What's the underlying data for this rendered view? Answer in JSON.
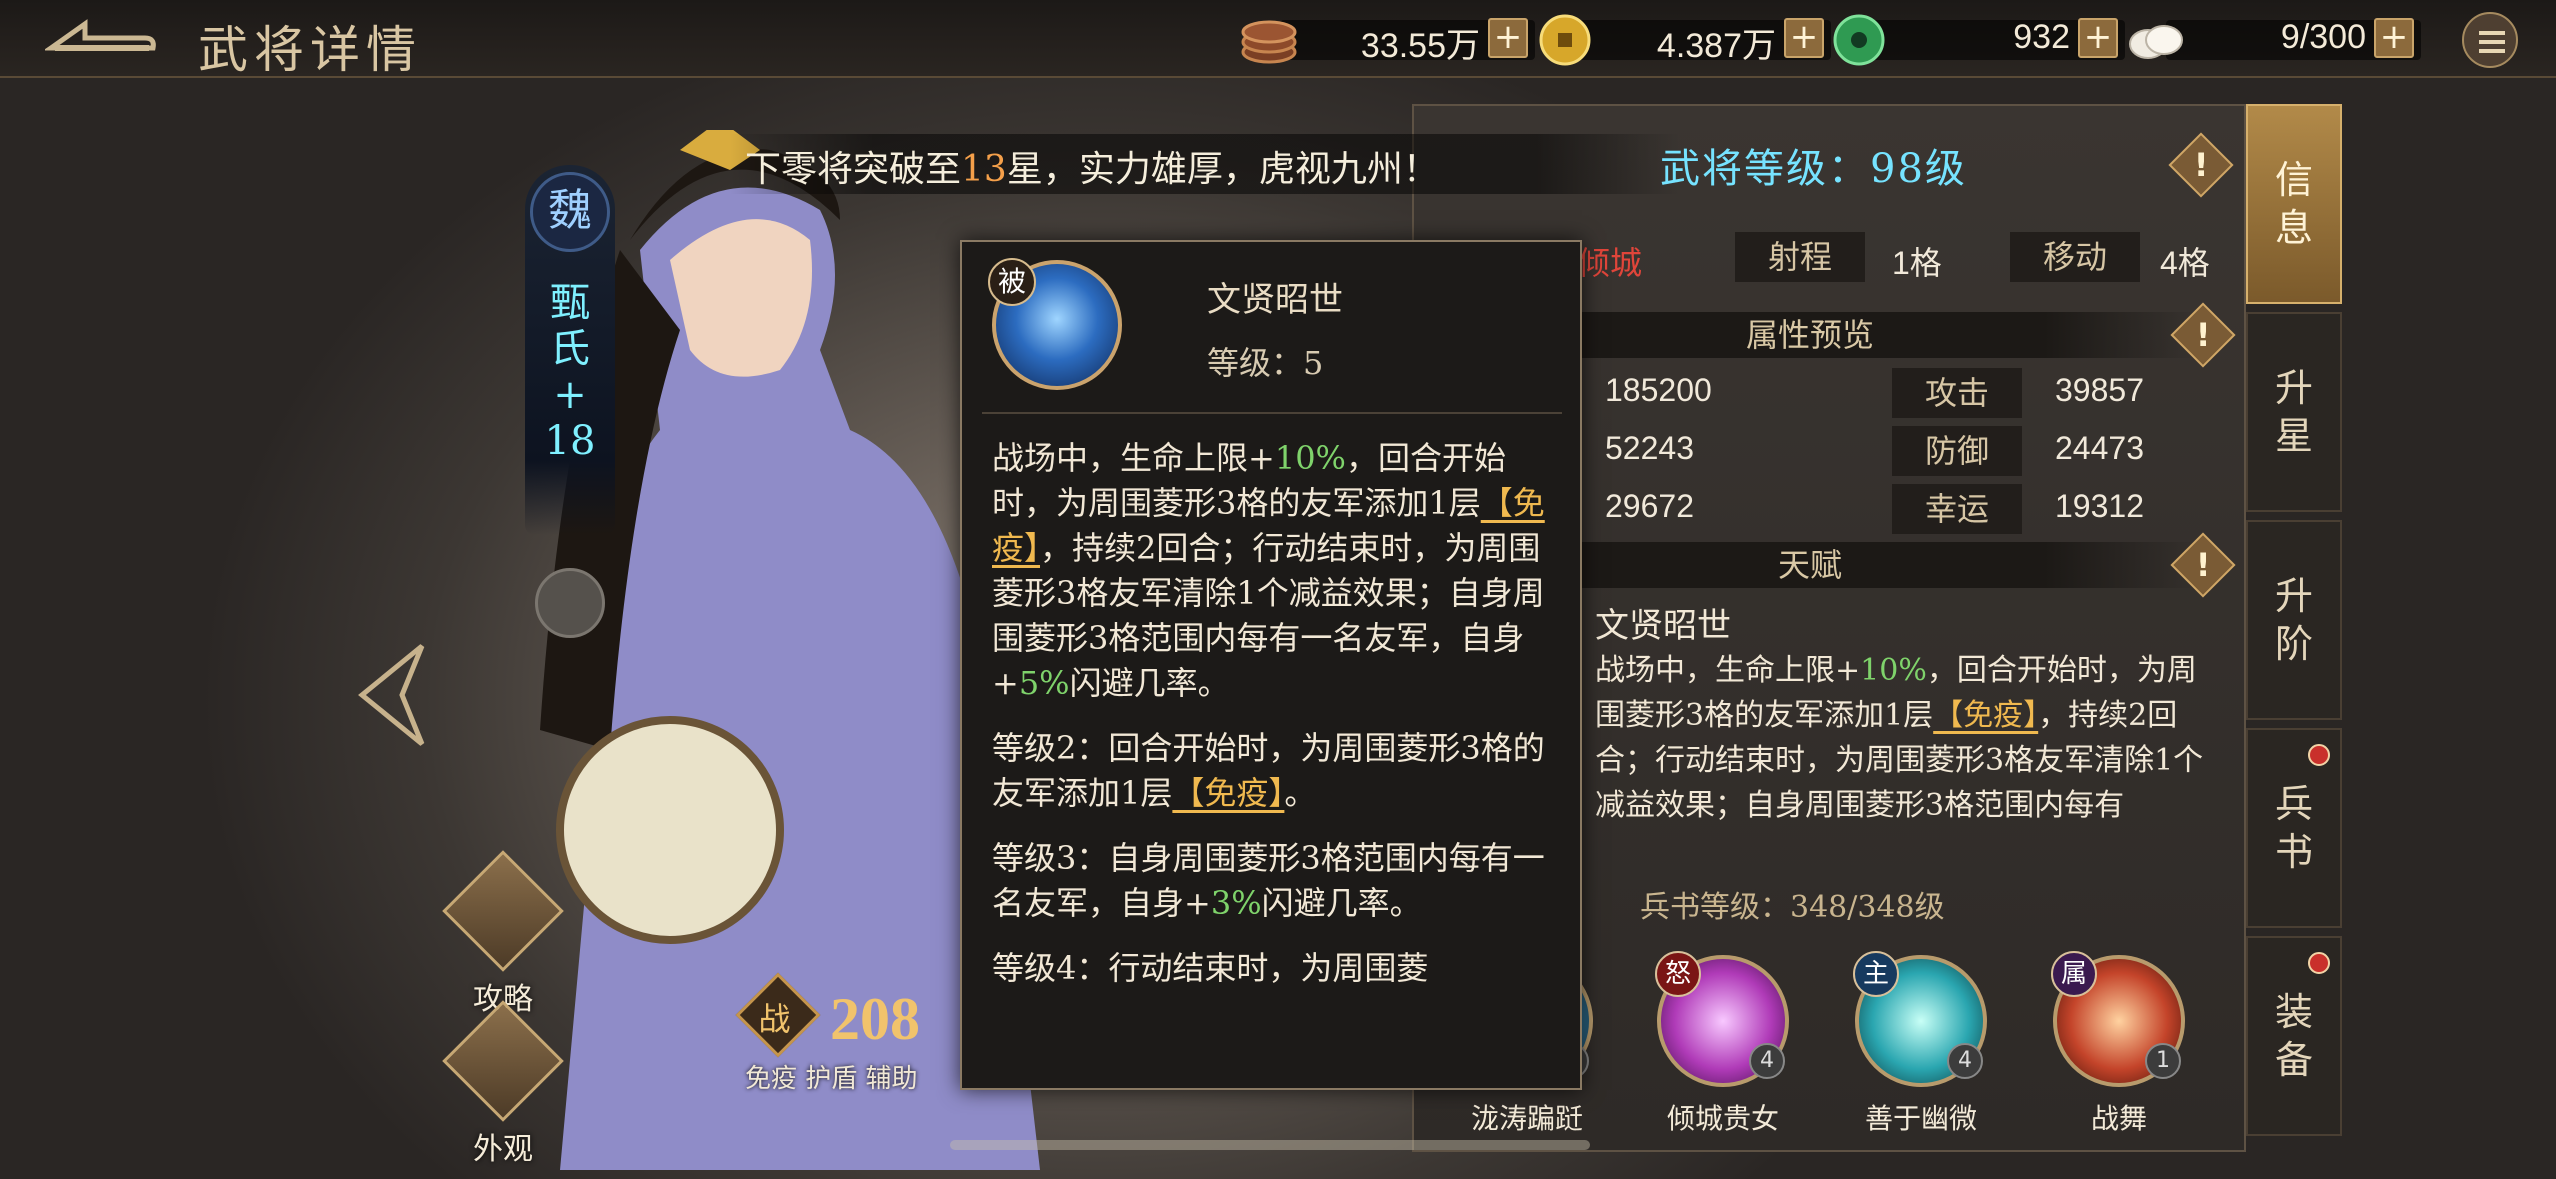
{
  "header": {
    "title": "武将详情",
    "resources": [
      {
        "icon": "copper-coins-icon",
        "value": "33.55万"
      },
      {
        "icon": "gold-coin-icon",
        "value": "4.387万"
      },
      {
        "icon": "jade-disc-icon",
        "value": "932"
      },
      {
        "icon": "steamed-bun-icon",
        "value": "9/300"
      }
    ],
    "plus": "+"
  },
  "hero": {
    "faction": "魏",
    "name": "甄氏\n+\n18",
    "power_prefix": "战",
    "power": "208",
    "tags": "免疫 护盾 辅助",
    "side_buttons": [
      "攻略",
      "外观"
    ]
  },
  "marquee": {
    "pre": "下零将突破至",
    "num": "13",
    "post": "星，实力雄厚，虎视九州！"
  },
  "panel": {
    "level_label": "武将等级：98级",
    "info_mark": "!",
    "top_row": {
      "trait": "倾城",
      "range_label": "射程",
      "range_value": "1格",
      "move_label": "移动",
      "move_value": "4格"
    },
    "attr_head": "属性预览",
    "attrs": [
      {
        "left_value": "185200",
        "label": "攻击",
        "value": "39857"
      },
      {
        "left_value": "52243",
        "label": "防御",
        "value": "24473"
      },
      {
        "left_value": "29672",
        "label": "幸运",
        "value": "19312"
      }
    ],
    "talent_head": "天赋",
    "talent_name": "文贤昭世",
    "talent_desc": {
      "a": "战场中，生命上限+",
      "b": "10%",
      "c": "，回合开始时，为周围菱形3格的友军添加1层",
      "d": "【免疫】",
      "e": "，持续2回合；行动结束时，为周围菱形3格友军清除1个减益效果；自身周围菱形3格范围内每有"
    },
    "bingshu_level": "兵书等级：348/348级",
    "skills": [
      {
        "name": "泷涛蹁跹",
        "badge": "",
        "level": "4",
        "color": "#2f6f8f"
      },
      {
        "name": "倾城贵女",
        "badge": "怒",
        "level": "4",
        "color": "#b03bb8"
      },
      {
        "name": "善于幽微",
        "badge": "主",
        "level": "4",
        "color": "#2aa6b0"
      },
      {
        "name": "战舞",
        "badge": "属",
        "level": "1",
        "color": "#c4442a"
      }
    ]
  },
  "tabs": [
    {
      "label": "信\n息",
      "active": true,
      "dot": false
    },
    {
      "label": "升\n星",
      "active": false,
      "dot": false
    },
    {
      "label": "升\n阶",
      "active": false,
      "dot": false
    },
    {
      "label": "兵\n书",
      "active": false,
      "dot": true
    },
    {
      "label": "装\n备",
      "active": false,
      "dot": true
    }
  ],
  "popup": {
    "tag": "被",
    "name": "文贤昭世",
    "level": "等级：5",
    "p1": {
      "a": "战场中，生命上限+",
      "b": "10%",
      "c": "，回合开始时，为周围菱形3格的友军添加1层",
      "d": "【免疫】",
      "e": "，持续2回合；行动结束时，为周围菱形3格友军清除1个减益效果；自身周围菱形3格范围内每有一名友军，自身+",
      "f": "5%",
      "g": "闪避几率。"
    },
    "p2": {
      "a": "等级2：回合开始时，为周围菱形3格的友军添加1层",
      "b": "【免疫】",
      "c": "。"
    },
    "p3": {
      "a": "等级3：自身周围菱形3格范围内每有一名友军，自身+",
      "b": "3%",
      "c": "闪避几率。"
    },
    "p4": {
      "a": "等级4：行动结束时，为周围菱"
    }
  }
}
